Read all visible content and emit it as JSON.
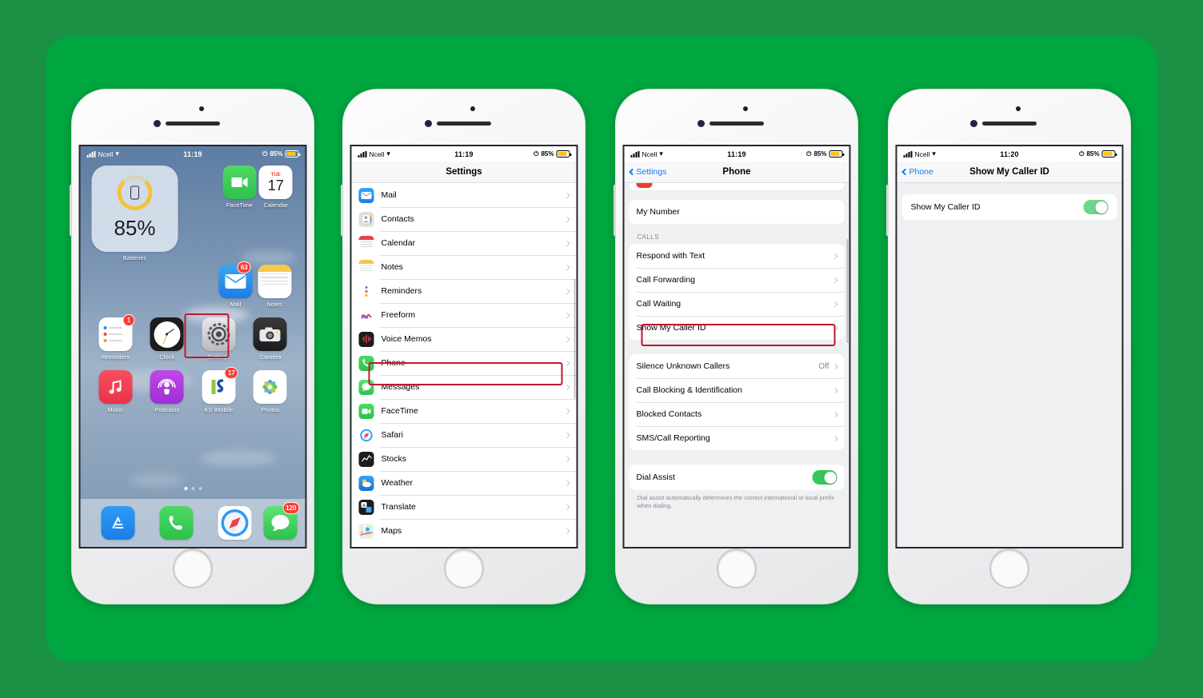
{
  "theme": {
    "bg_outer": "#1a9144",
    "bg_card": "#00a63f",
    "accent_blue": "#0a7cff",
    "highlight_red": "#c0172c",
    "toggle_green": "#34c759"
  },
  "phones": [
    {
      "id": "home-screen",
      "status": {
        "carrier": "Ncell",
        "time": "11:19",
        "battery": "85%"
      },
      "widget": {
        "percent": "85%",
        "label": "Batteries"
      },
      "rows": [
        [
          {
            "label": "FaceTime",
            "icon": "facetime-icon",
            "badge": ""
          },
          {
            "label": "Calendar",
            "icon": "calendar-icon",
            "badge": "",
            "day": "17",
            "weekday": "TUE"
          }
        ],
        [
          {
            "label": "Mail",
            "icon": "mail-icon",
            "badge": "63"
          },
          {
            "label": "Notes",
            "icon": "notes-icon",
            "badge": ""
          }
        ],
        [
          {
            "label": "Reminders",
            "icon": "reminders-icon",
            "badge": "1"
          },
          {
            "label": "Clock",
            "icon": "clock-icon",
            "badge": ""
          },
          {
            "label": "Settings",
            "icon": "settings-icon",
            "badge": "",
            "highlighted": true
          },
          {
            "label": "Camera",
            "icon": "camera-icon",
            "badge": ""
          }
        ],
        [
          {
            "label": "Music",
            "icon": "music-icon",
            "badge": ""
          },
          {
            "label": "Podcasts",
            "icon": "podcasts-icon",
            "badge": ""
          },
          {
            "label": "KS iMobile",
            "icon": "ks-imobile-icon",
            "badge": "17"
          },
          {
            "label": "Photos",
            "icon": "photos-icon",
            "badge": ""
          }
        ]
      ],
      "dock": [
        {
          "label": "App Store",
          "icon": "app-store-icon",
          "badge": ""
        },
        {
          "label": "Phone",
          "icon": "phone-icon",
          "badge": ""
        },
        {
          "label": "Safari",
          "icon": "safari-icon",
          "badge": ""
        },
        {
          "label": "Messages",
          "icon": "messages-icon",
          "badge": "120"
        }
      ]
    },
    {
      "id": "settings-list",
      "status": {
        "carrier": "Ncell",
        "time": "11:19",
        "battery": "85%"
      },
      "nav": {
        "title": "Settings",
        "back": ""
      },
      "items": [
        {
          "label": "Mail",
          "icon": "mail-icon"
        },
        {
          "label": "Contacts",
          "icon": "contacts-icon"
        },
        {
          "label": "Calendar",
          "icon": "calendar-icon"
        },
        {
          "label": "Notes",
          "icon": "notes-icon"
        },
        {
          "label": "Reminders",
          "icon": "reminders-icon"
        },
        {
          "label": "Freeform",
          "icon": "freeform-icon"
        },
        {
          "label": "Voice Memos",
          "icon": "voice-memos-icon"
        },
        {
          "label": "Phone",
          "icon": "phone-icon",
          "highlighted": true
        },
        {
          "label": "Messages",
          "icon": "messages-icon"
        },
        {
          "label": "FaceTime",
          "icon": "facetime-icon"
        },
        {
          "label": "Safari",
          "icon": "safari-icon"
        },
        {
          "label": "Stocks",
          "icon": "stocks-icon"
        },
        {
          "label": "Weather",
          "icon": "weather-icon"
        },
        {
          "label": "Translate",
          "icon": "translate-icon"
        },
        {
          "label": "Maps",
          "icon": "maps-icon"
        }
      ]
    },
    {
      "id": "phone-settings",
      "status": {
        "carrier": "Ncell",
        "time": "11:19",
        "battery": "85%"
      },
      "nav": {
        "title": "Phone",
        "back": "Settings"
      },
      "my_number": {
        "label": "My Number",
        "value": ""
      },
      "calls_header": "CALLS",
      "calls": [
        {
          "label": "Respond with Text"
        },
        {
          "label": "Call Forwarding"
        },
        {
          "label": "Call Waiting"
        },
        {
          "label": "Show My Caller ID",
          "highlighted": true
        }
      ],
      "blocking": [
        {
          "label": "Silence Unknown Callers",
          "value": "Off"
        },
        {
          "label": "Call Blocking & Identification"
        },
        {
          "label": "Blocked Contacts"
        },
        {
          "label": "SMS/Call Reporting"
        }
      ],
      "dial_assist": {
        "label": "Dial Assist",
        "enabled": true
      },
      "dial_assist_note": "Dial assist automatically determines the correct international or local prefix when dialing."
    },
    {
      "id": "caller-id",
      "status": {
        "carrier": "Ncell",
        "time": "11:20",
        "battery": "85%"
      },
      "nav": {
        "title": "Show My Caller ID",
        "back": "Phone"
      },
      "toggle": {
        "label": "Show My Caller ID",
        "enabled": true
      }
    }
  ]
}
